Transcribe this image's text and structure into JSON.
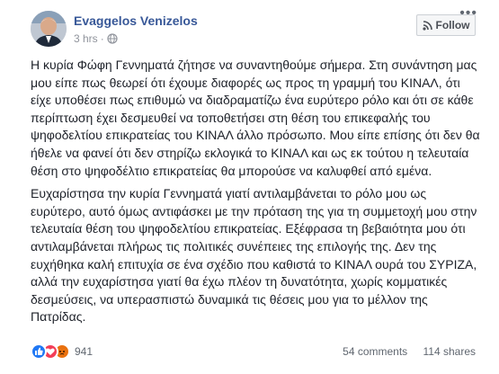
{
  "post": {
    "author": "Evaggelos Venizelos",
    "time": "3 hrs",
    "separator": "·",
    "follow_label": "Follow",
    "paragraphs": [
      "Η κυρία Φώφη Γεννηματά ζήτησε να συναντηθούμε σήμερα. Στη συνάντηση μας μου είπε πως θεωρεί ότι έχουμε διαφορές ως προς τη γραμμή του ΚΙΝΑΛ, ότι είχε υποθέσει πως επιθυμώ να διαδραματίζω ένα ευρύτερο ρόλο και ότι σε κάθε περίπτωση έχει δεσμευθεί να τοποθετήσει στη θέση του επικεφαλής του ψηφοδελτίου επικρατείας του ΚΙΝΑΛ άλλο πρόσωπο. Μου είπε επίσης ότι δεν θα ήθελε να φανεί ότι δεν στηρίζω εκλογικά το ΚΙΝΑΛ και ως εκ τούτου η τελευταία θέση στο ψηφοδέλτιο επικρατείας θα μπορούσε να καλυφθεί από εμένα.",
      "Ευχαρίστησα την κυρία Γεννηματά γιατί αντιλαμβάνεται το ρόλο μου ως ευρύτερο, αυτό όμως αντιφάσκει με την πρόταση της για τη συμμετοχή μου στην τελευταία θέση του ψηφοδελτίου επικρατείας. Εξέφρασα τη βεβαιότητα μου ότι αντιλαμβάνεται πλήρως τις πολιτικές συνέπειες της επιλογής της. Δεν της ευχήθηκα καλή επιτυχία σε ένα σχέδιο που καθιστά το ΚΙΝΑΛ ουρά του ΣΥΡΙΖΑ, αλλά την ευχαρίστησα γιατί θα έχω πλέον τη δυνατότητα, χωρίς κομματικές δεσμεύσεις, να υπερασπιστώ δυναμικά τις θέσεις μου για το μέλλον της Πατρίδας."
    ]
  },
  "footer": {
    "reaction_icons": [
      "like-icon",
      "love-icon",
      "angry-icon"
    ],
    "reaction_count": "941",
    "comments": "54 comments",
    "shares": "114 shares"
  },
  "colors": {
    "author_link": "#385898",
    "meta_gray": "#90949c",
    "like_blue": "#2078f4",
    "love_red": "#f33e58",
    "angry_orange": "#e9710f"
  }
}
